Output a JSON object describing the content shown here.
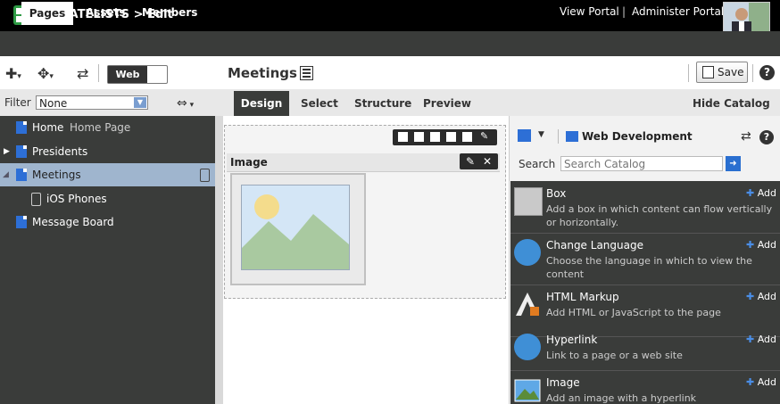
{
  "header": {
    "title": "PHILATELISTS > Edit"
  },
  "nav": {
    "tabs": [
      "Pages",
      "Assets",
      "Members"
    ],
    "links": [
      "View Portal",
      "|",
      "Administer Portal"
    ]
  },
  "toolbar": {
    "web_toggle": "Web",
    "page_title": "Meetings",
    "save_label": "Save",
    "help": "?"
  },
  "filter": {
    "label": "Filter",
    "value": "None"
  },
  "design_tabs": [
    "Design",
    "Select",
    "Structure",
    "Preview"
  ],
  "hide_catalog": "Hide Catalog",
  "tree": [
    {
      "label": "Home",
      "sub": "Home Page"
    },
    {
      "label": "Presidents",
      "sub": ""
    },
    {
      "label": "Meetings",
      "sub": ""
    },
    {
      "label": "iOS Phones",
      "sub": ""
    },
    {
      "label": "Message Board",
      "sub": ""
    }
  ],
  "canvas": {
    "image_title": "Image"
  },
  "catalog": {
    "folder": "Web Development",
    "help": "?",
    "search_label": "Search",
    "search_placeholder": "Search Catalog",
    "items": [
      {
        "name": "Box",
        "desc": "Add a box in which content can flow vertically or horizontally.",
        "add": "Add"
      },
      {
        "name": "Change Language",
        "desc": "Choose the language in which to view the content",
        "add": "Add"
      },
      {
        "name": "HTML Markup",
        "desc": "Add HTML or JavaScript to the page",
        "add": "Add"
      },
      {
        "name": "Hyperlink",
        "desc": "Link to a page or a web site",
        "add": "Add"
      },
      {
        "name": "Image",
        "desc": "Add an image with a hyperlink",
        "add": "Add"
      }
    ]
  },
  "colors": {
    "accent": "#2d6fd6",
    "dark_panel": "#3a3c3a",
    "selected_row": "#9fb5ce",
    "logo_green": "#2e9b45"
  }
}
